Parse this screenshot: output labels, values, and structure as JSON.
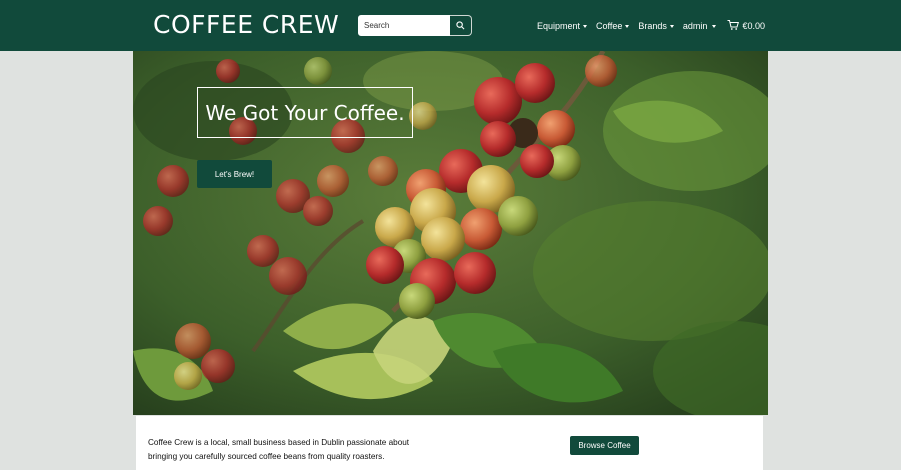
{
  "brand": {
    "name": "COFFEE CREW"
  },
  "search": {
    "placeholder": "Search"
  },
  "nav": {
    "items": [
      {
        "label": "Equipment"
      },
      {
        "label": "Coffee"
      },
      {
        "label": "Brands"
      },
      {
        "label": "admin"
      }
    ],
    "cart_total": "€0.00"
  },
  "hero": {
    "headline": "We Got Your Coffee.",
    "cta_label": "Let's Brew!"
  },
  "info": {
    "text": "Coffee Crew is a local, small business based in Dublin passionate about bringing you carefully sourced coffee beans from quality roasters.",
    "browse_label": "Browse Coffee"
  },
  "icons": {
    "search": "search-icon",
    "cart": "cart-icon"
  },
  "colors": {
    "primary": "#114a3b",
    "background": "#dfe2e0"
  }
}
